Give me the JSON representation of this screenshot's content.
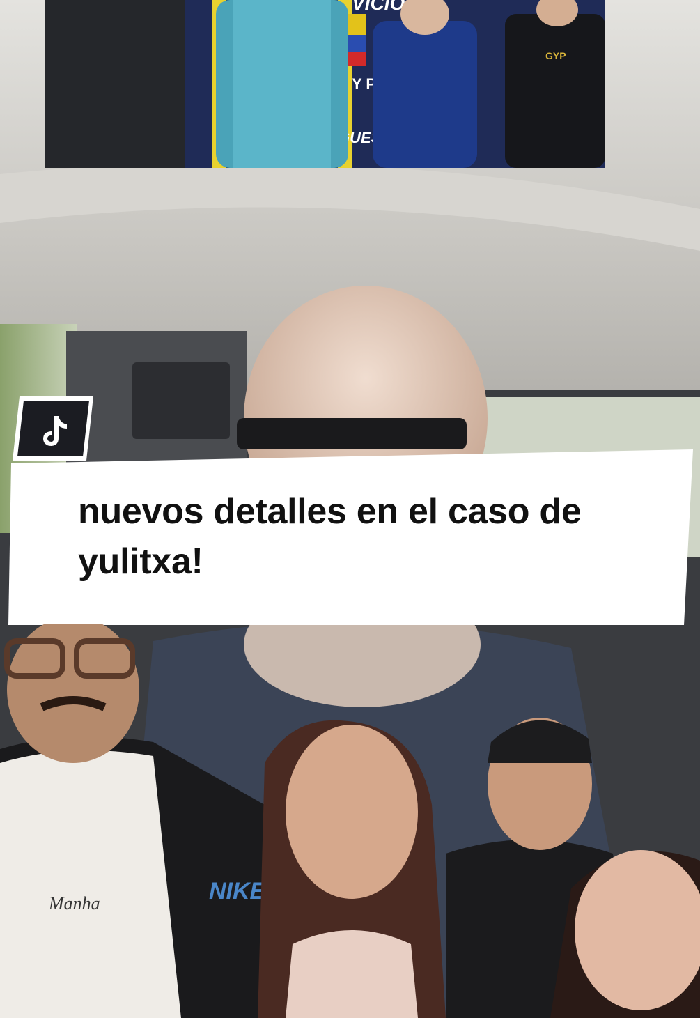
{
  "video": {
    "caption": "nuevos detalles en el caso de yulitxa!",
    "platform_icon": "tiktok-icon",
    "inset_photo": {
      "sign_text_top": "VICIO",
      "sign_text_mid": "Y P",
      "sign_text_low": "GUES",
      "badge_text": "GYP"
    },
    "overlay_people": [
      {
        "id": "man-with-glasses",
        "shirt_text": "Manha",
        "jacket_logo": "NIKE"
      },
      {
        "id": "woman-center"
      },
      {
        "id": "man-with-cap"
      },
      {
        "id": "young-woman"
      }
    ]
  },
  "colors": {
    "caption_card": "#ffffff",
    "caption_text": "#111111",
    "badge_bg": "#1b1c22",
    "car_ceiling": "#c9c7c2"
  }
}
